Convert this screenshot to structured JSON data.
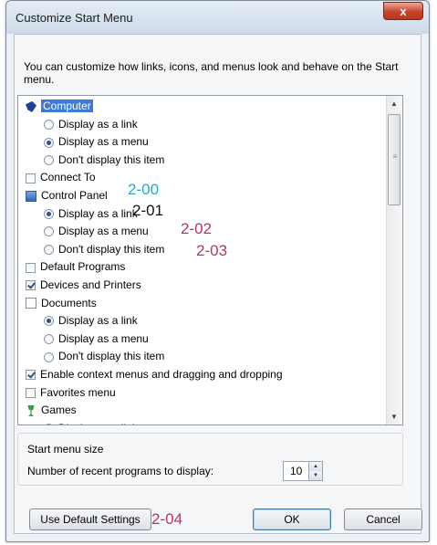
{
  "window": {
    "title": "Customize Start Menu",
    "close_label": "x"
  },
  "description": "You can customize how links, icons, and menus look and behave on the Start menu.",
  "list": {
    "items": [
      {
        "label": "Computer",
        "kind": "category",
        "icon": "computer-icon"
      },
      {
        "label": "Display as a link",
        "kind": "radio",
        "selected": false
      },
      {
        "label": "Display as a menu",
        "kind": "radio",
        "selected": true
      },
      {
        "label": "Don't display this item",
        "kind": "radio",
        "selected": false
      },
      {
        "label": "Connect To",
        "kind": "checkbox",
        "checked": false
      },
      {
        "label": "Control Panel",
        "kind": "category",
        "icon": "control-panel-icon"
      },
      {
        "label": "Display as a link",
        "kind": "radio",
        "selected": true
      },
      {
        "label": "Display as a menu",
        "kind": "radio",
        "selected": false
      },
      {
        "label": "Don't display this item",
        "kind": "radio",
        "selected": false
      },
      {
        "label": "Default Programs",
        "kind": "checkbox",
        "checked": false
      },
      {
        "label": "Devices and Printers",
        "kind": "checkbox",
        "checked": true
      },
      {
        "label": "Documents",
        "kind": "category",
        "icon": "documents-icon"
      },
      {
        "label": "Display as a link",
        "kind": "radio",
        "selected": true
      },
      {
        "label": "Display as a menu",
        "kind": "radio",
        "selected": false
      },
      {
        "label": "Don't display this item",
        "kind": "radio",
        "selected": false
      },
      {
        "label": "Enable context menus and dragging and dropping",
        "kind": "checkbox",
        "checked": true
      },
      {
        "label": "Favorites menu",
        "kind": "checkbox",
        "checked": false
      },
      {
        "label": "Games",
        "kind": "category",
        "icon": "games-icon"
      },
      {
        "label": "Display as a link",
        "kind": "radio",
        "selected": false
      }
    ]
  },
  "annotations": {
    "a200": "2-00",
    "a201": "2-01",
    "a202": "2-02",
    "a203": "2-03",
    "a204": "2-04",
    "color_teal": "#2aa6c8",
    "color_black": "#111111",
    "color_magenta": "#b8326e"
  },
  "start_menu_size": {
    "group_title": "Start menu size",
    "recent_label": "Number of recent programs to display:",
    "recent_value": "10"
  },
  "buttons": {
    "defaults": "Use Default Settings",
    "ok": "OK",
    "cancel": "Cancel"
  }
}
